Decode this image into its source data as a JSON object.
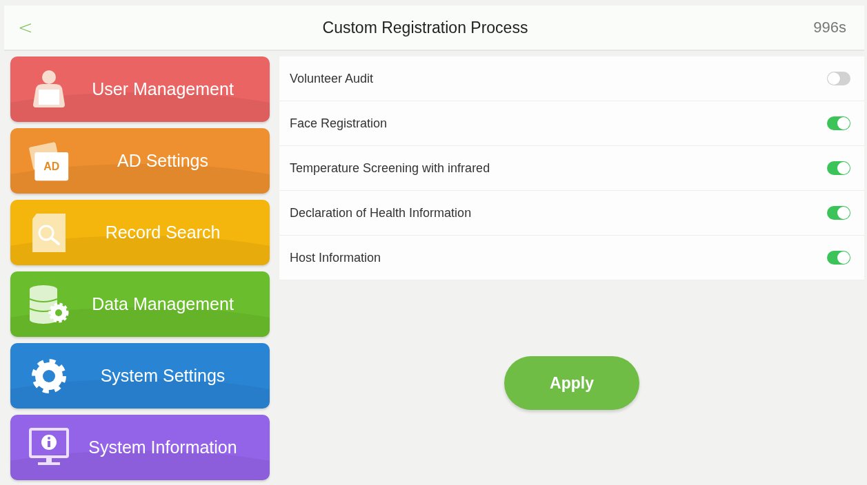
{
  "header": {
    "back": "<",
    "title": "Custom Registration Process",
    "countdown": "996s"
  },
  "menu": [
    {
      "label": "User Management",
      "kind": "user",
      "color": "#ea6464"
    },
    {
      "label": "AD Settings",
      "kind": "ad",
      "icon_text": "AD",
      "color": "#ee9030"
    },
    {
      "label": "Record Search",
      "kind": "search",
      "color": "#f4b50c"
    },
    {
      "label": "Data Management",
      "kind": "database",
      "color": "#6abd2c"
    },
    {
      "label": "System Settings",
      "kind": "gear",
      "color": "#2a84d4"
    },
    {
      "label": "System Information",
      "kind": "info",
      "color": "#9464e8"
    }
  ],
  "settings": [
    {
      "label": "Volunteer Audit",
      "on": false
    },
    {
      "label": "Face Registration",
      "on": true
    },
    {
      "label": "Temperature Screening with infrared",
      "on": true
    },
    {
      "label": "Declaration of Health Information",
      "on": true
    },
    {
      "label": "Host Information",
      "on": true
    }
  ],
  "apply_button": "Apply"
}
